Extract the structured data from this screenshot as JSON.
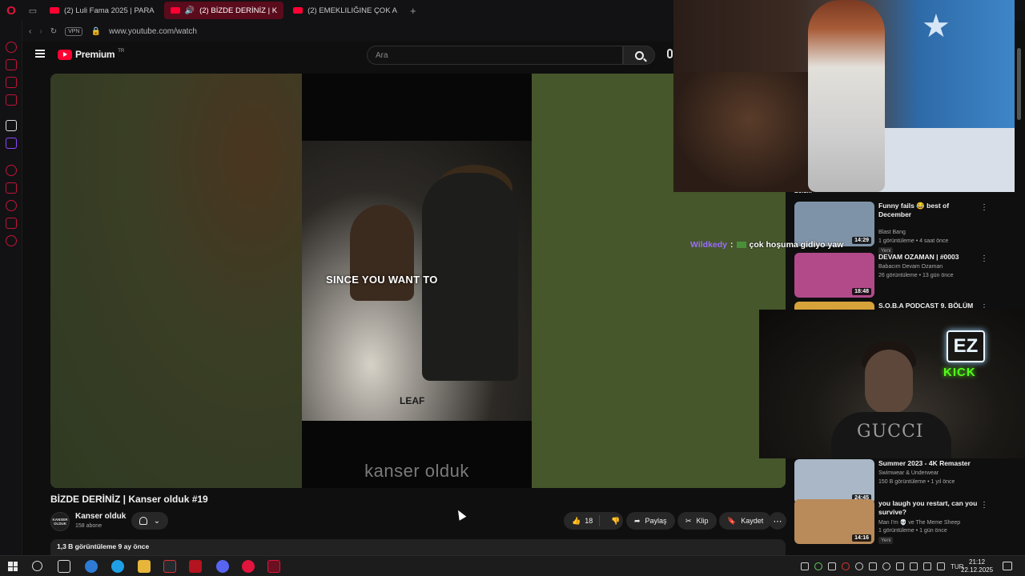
{
  "browser": {
    "tabs": [
      {
        "label": "(2) Luli Fama 2025 | PARA"
      },
      {
        "label": "(2) BİZDE DERİNİZ | K"
      },
      {
        "label": "(2) EMEKLILIĞINE ÇOK A"
      }
    ],
    "vpn_label": "VPN",
    "url": "www.youtube.com/watch"
  },
  "youtube": {
    "brand": "Premium",
    "region": "TR",
    "search_placeholder": "Ara"
  },
  "video": {
    "caption": "SINCE YOU WANT TO",
    "leaf_text": "LEAF",
    "watermark": "kanser olduk",
    "title": "BİZDE DERİNİZ | Kanser olduk #19",
    "channel_avatar_text": "KANSER OLDUK",
    "channel": "Kanser olduk",
    "subscribers": "158 abone",
    "likes": "18",
    "share_label": "Paylaş",
    "clip_label": "Klip",
    "save_label": "Kaydet",
    "views_date": "1,3 B görüntüleme  9 ay önce"
  },
  "recommendations": {
    "partial_label": "Bölüm",
    "items": [
      {
        "title": "Funny fails 😂 best of December",
        "channel": "Blast Bang",
        "meta": "1 görüntüleme • 4 saat önce",
        "badge": "Yeni",
        "duration": "14:29",
        "thumb_color": "#7f93a8"
      },
      {
        "title": "DEVAM OZAMAN | #0003",
        "channel": "Babacım Devam Ozaman",
        "meta": "26 görüntüleme • 13 gün önce",
        "badge": "",
        "duration": "18:48",
        "thumb_color": "#b24a8a"
      },
      {
        "title": "S.O.B.A PODCAST 9. BÖLÜM",
        "channel": "",
        "meta": "",
        "badge": "",
        "duration": "",
        "thumb_color": "#d6a23a"
      },
      {
        "title": "Summer 2023 - 4K Remaster",
        "channel": "Swimwear & Underwear",
        "meta": "150 B görüntüleme • 1 yıl önce",
        "badge": "",
        "duration": "24:45",
        "thumb_color": "#a9b7c6"
      },
      {
        "title": "you laugh you restart, can you survive?",
        "channel": "Man I'm 💀 ve The Meme Sheep",
        "meta": "1 görüntüleme • 1 gün önce",
        "badge": "Yeni",
        "duration": "14:16",
        "thumb_color": "#b98a5a"
      }
    ]
  },
  "chat": {
    "user": "Wildkedy",
    "separator": ":",
    "message": "çok hoşuma gidiyo yaw"
  },
  "webcam": {
    "shirt_text": "GUCCI",
    "logo_text": "EZ",
    "kick_text": "KICK"
  },
  "taskbar": {
    "language": "TUR",
    "time": "21:12",
    "date": "22.12.2025"
  },
  "colors": {
    "accent": "#ff0033",
    "opera_red": "#e0143c",
    "chat_user": "#9a6bff",
    "kick_green": "#53fc18"
  }
}
